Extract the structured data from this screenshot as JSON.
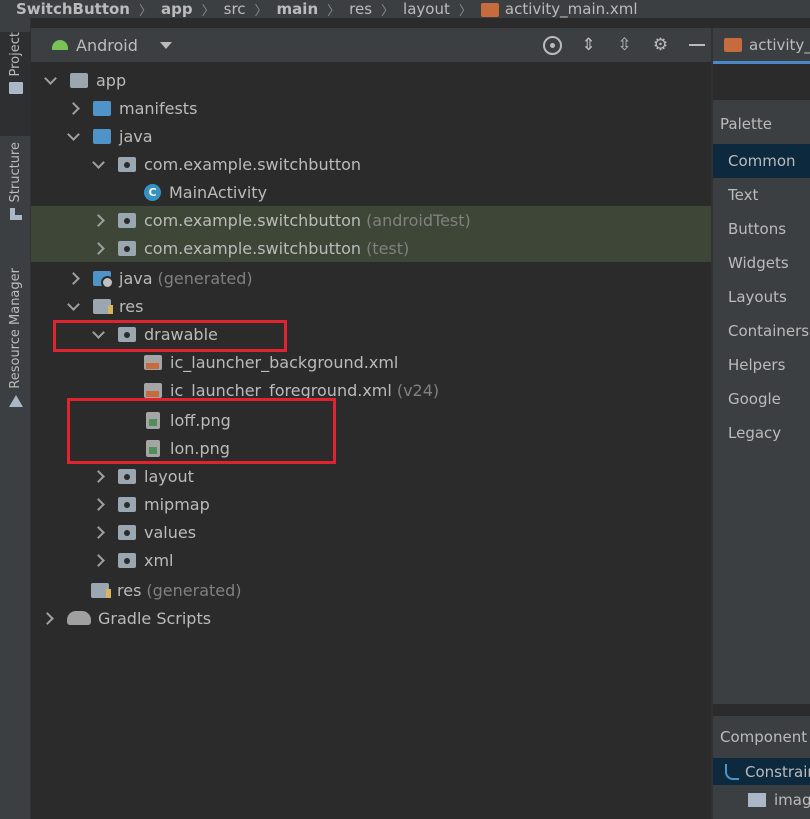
{
  "breadcrumb": [
    "SwitchButton",
    "app",
    "src",
    "main",
    "res",
    "layout",
    "activity_main.xml"
  ],
  "toolstrip": {
    "project": "Project",
    "structure": "Structure",
    "resource_manager": "Resource Manager"
  },
  "panel": {
    "title": "Android"
  },
  "tree": {
    "app": "app",
    "manifests": "manifests",
    "java": "java",
    "pkg_main": "com.example.switchbutton",
    "main_activity": "MainActivity",
    "pkg_android_test": "com.example.switchbutton",
    "pkg_android_test_suffix": "(androidTest)",
    "pkg_test": "com.example.switchbutton",
    "pkg_test_suffix": "(test)",
    "java_generated": "java",
    "java_generated_suffix": "(generated)",
    "res": "res",
    "drawable": "drawable",
    "ic_bg": "ic_launcher_background.xml",
    "ic_fg": "ic_launcher_foreground.xml",
    "ic_fg_suffix": "(v24)",
    "loff": "loff.png",
    "lon": "lon.png",
    "layout": "layout",
    "mipmap": "mipmap",
    "values": "values",
    "xml": "xml",
    "res_generated": "res",
    "res_generated_suffix": "(generated)",
    "gradle": "Gradle Scripts"
  },
  "editor_tab": {
    "label": "activity_main.xml"
  },
  "palette": {
    "title": "Palette",
    "items": [
      "Common",
      "Text",
      "Buttons",
      "Widgets",
      "Layouts",
      "Containers",
      "Helpers",
      "Google",
      "Legacy"
    ]
  },
  "component_tree": {
    "title": "Component Tree",
    "root": "ConstraintLayout",
    "child": "imageView"
  },
  "colors": {
    "highlight_box": "#e0232f",
    "selection": "#0d293e",
    "test_row_bg": "#3d4637"
  }
}
